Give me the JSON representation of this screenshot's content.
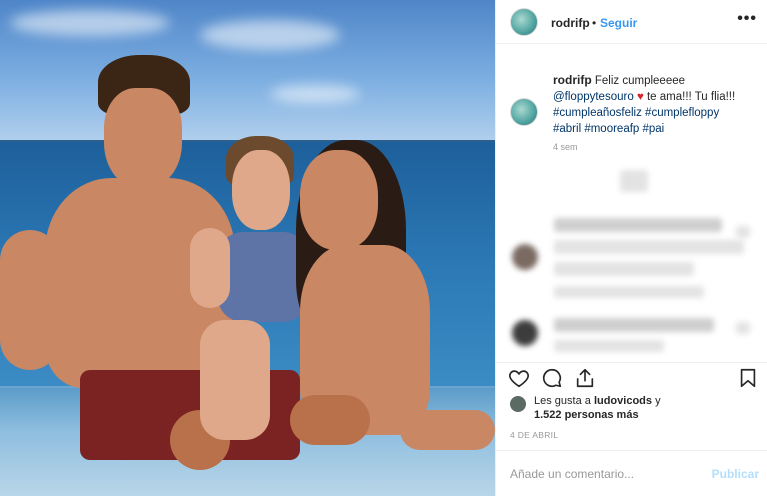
{
  "post": {
    "photo_alt": "Family smiling in an infinity pool by the sea",
    "header": {
      "username": "rodrifp",
      "separator": "•",
      "follow_label": "Seguir",
      "more_label": "•••"
    },
    "caption": {
      "username": "rodrifp",
      "text_1": "Feliz cumpleeeee",
      "mention": "@floppytesouro",
      "heart": "♥",
      "text_2": "te ama!!! Tu flia!!!",
      "hashtags_line_1": "#cumpleañosfeliz #cumplefloppy",
      "hashtags_line_2": "#abril #mooreafp #pai",
      "age": "4 sem"
    },
    "likes": {
      "prefix": "Les gusta a",
      "user": "ludovicods",
      "connector": "y",
      "count": "1.522 personas más"
    },
    "date": "4 DE ABRIL",
    "add_comment": {
      "placeholder": "Añade un comentario...",
      "publish_label": "Publicar"
    },
    "colors": {
      "link_blue": "#3897f0",
      "mention_blue": "#003569",
      "heart_red": "#d9262e",
      "publish_disabled": "#b2dffc"
    },
    "icons": [
      "heart-icon",
      "comment-icon",
      "share-icon",
      "bookmark-icon",
      "more-icon"
    ]
  }
}
